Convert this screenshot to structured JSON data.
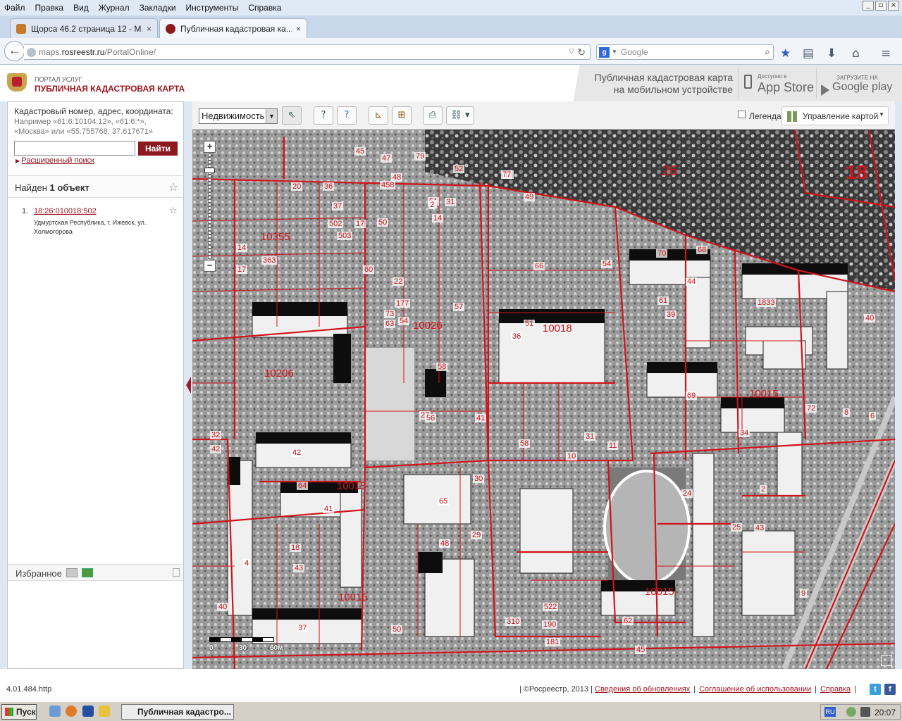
{
  "menubar": {
    "items": [
      "Файл",
      "Правка",
      "Вид",
      "Журнал",
      "Закладки",
      "Инструменты",
      "Справка"
    ]
  },
  "window_buttons": [
    "_",
    "▫",
    "×"
  ],
  "tabs": [
    {
      "title": "Щорса 46.2 страница 12 - М...",
      "active": false
    },
    {
      "title": "Публичная кадастровая ка...",
      "active": true
    }
  ],
  "tabbar": {
    "new_tab": "+",
    "close": "×"
  },
  "navbar": {
    "url_prefix": "maps.",
    "url_domain": "rosreestr.ru",
    "url_path": "/PortalOnline/",
    "search_placeholder": "Google"
  },
  "header": {
    "portal": "ПОРТАЛ УСЛУГ",
    "title": "ПУБЛИЧНАЯ КАДАСТРОВАЯ КАРТА",
    "mobile_text_1": "Публичная кадастровая карта",
    "mobile_text_2": "на мобильном устройстве",
    "appstore_small": "Доступно в",
    "appstore_big": "App Store",
    "gplay_small": "ЗАГРУЗИТЕ НА",
    "gplay_big": "Google play"
  },
  "search": {
    "title": "Кадастровый номер, адрес, координата:",
    "hint": "Например «61:6:10104:12», «61:6:*», «Москва» или «55.755768, 37.617671»",
    "value": "",
    "button": "Найти",
    "advanced": "Расширенный поиск"
  },
  "results": {
    "found_prefix": "Найден ",
    "found_count": "1 объект",
    "items": [
      {
        "num": "1.",
        "id": "18:26:010018:502",
        "address": "Удмуртская Республика, г. Ижевск, ул. Холмогорова"
      }
    ]
  },
  "favorites": {
    "title": "Избранное"
  },
  "toolbar": {
    "layer": "Недвижимость",
    "legend": "Легенда",
    "map_control": "Управление картой"
  },
  "map": {
    "scale_labels": [
      "0",
      "30",
      "60м"
    ],
    "zoom_in": "+",
    "zoom_out": "−",
    "labels": [
      "26",
      "18",
      "10355",
      "10026",
      "10018",
      "10206",
      "10015",
      "10015",
      "10015",
      "10015",
      "10015",
      "20",
      "36",
      "37",
      "45",
      "47",
      "48",
      "52",
      "51",
      "1",
      "2",
      "31",
      "17",
      "502",
      "503",
      "458",
      "60",
      "177",
      "79",
      "14",
      "13",
      "77",
      "49",
      "50",
      "57",
      "54",
      "44",
      "1833",
      "36",
      "66",
      "61",
      "51",
      "58",
      "73",
      "63",
      "54",
      "22",
      "39",
      "70",
      "68",
      "69",
      "72",
      "34",
      "2",
      "42",
      "64",
      "41",
      "65",
      "48",
      "18",
      "43",
      "4",
      "37",
      "40",
      "50",
      "310",
      "522",
      "190",
      "181",
      "62",
      "45",
      "24",
      "25",
      "43",
      "9",
      "6",
      "40",
      "8",
      "10",
      "11",
      "29",
      "30",
      "27",
      "56",
      "41",
      "58",
      "31",
      "32",
      "42",
      "14",
      "17",
      "363"
    ]
  },
  "footer": {
    "version": "4.01.484.http",
    "copyright": "| ©Росреестр, 2013 |",
    "link1": "Сведения об обновлениях",
    "link2": "Соглашение об использовании",
    "link3": "Справка"
  },
  "taskbar": {
    "start": "Пуск",
    "active_window": "Публичная кадастро...",
    "lang": "RU",
    "time": "20:07"
  },
  "colors": {
    "accent": "#a1141c",
    "parcel_line": "#d0141c"
  }
}
